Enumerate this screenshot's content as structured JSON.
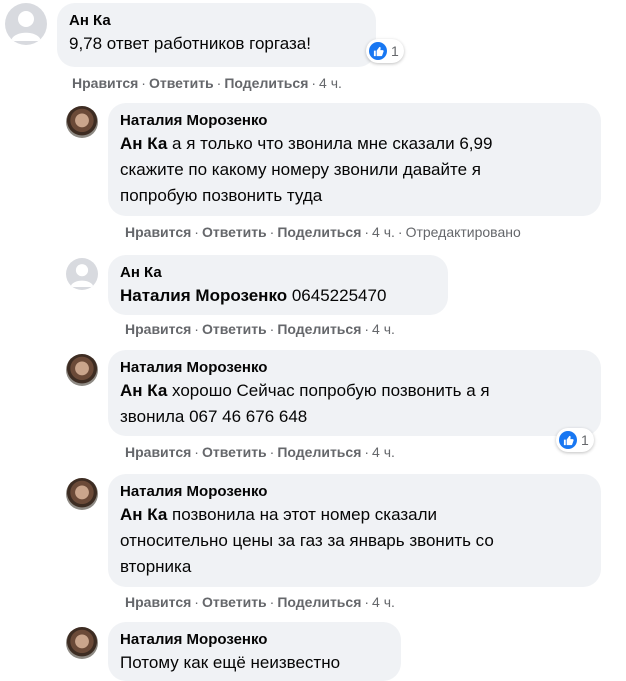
{
  "comments": [
    {
      "author": "Ан Ка",
      "text": "9,78 ответ работников горгаза!",
      "reaction_count": "1",
      "actions": {
        "like": "Нравится",
        "reply": "Ответить",
        "share": "Поделиться",
        "time": "4 ч."
      }
    },
    {
      "author": "Наталия Морозенко",
      "mention": "Ан Ка",
      "text_line1": " а я только что звонила мне сказали 6,99",
      "text_line2": "скажите по какому номеру звонили давайте я",
      "text_line3": "попробую позвонить туда",
      "actions": {
        "like": "Нравится",
        "reply": "Ответить",
        "share": "Поделиться",
        "time": "4 ч.",
        "edited": "Отредактировано"
      }
    },
    {
      "author": "Ан Ка",
      "mention": "Наталия Морозенко",
      "text": " 0645225470",
      "actions": {
        "like": "Нравится",
        "reply": "Ответить",
        "share": "Поделиться",
        "time": "4 ч."
      }
    },
    {
      "author": "Наталия Морозенко",
      "mention": "Ан Ка",
      "text_line1": " хорошо Сейчас попробую позвонить а я",
      "text_line2": "звонила 067 46 676 648",
      "reaction_count": "1",
      "actions": {
        "like": "Нравится",
        "reply": "Ответить",
        "share": "Поделиться",
        "time": "4 ч."
      }
    },
    {
      "author": "Наталия Морозенко",
      "mention": "Ан Ка",
      "text_line1": " позвонила на этот номер сказали",
      "text_line2": "относительно цены за газ за январь звонить со",
      "text_line3": "вторника",
      "actions": {
        "like": "Нравится",
        "reply": "Ответить",
        "share": "Поделиться",
        "time": "4 ч."
      }
    },
    {
      "author": "Наталия Морозенко",
      "text": "Потому как ещё неизвестно"
    }
  ],
  "icons": {
    "like": "thumbs-up-icon",
    "avatar_default": "person-icon"
  },
  "colors": {
    "bubble": "#f0f2f5",
    "meta": "#65676b",
    "like_blue": "#1877f2"
  }
}
